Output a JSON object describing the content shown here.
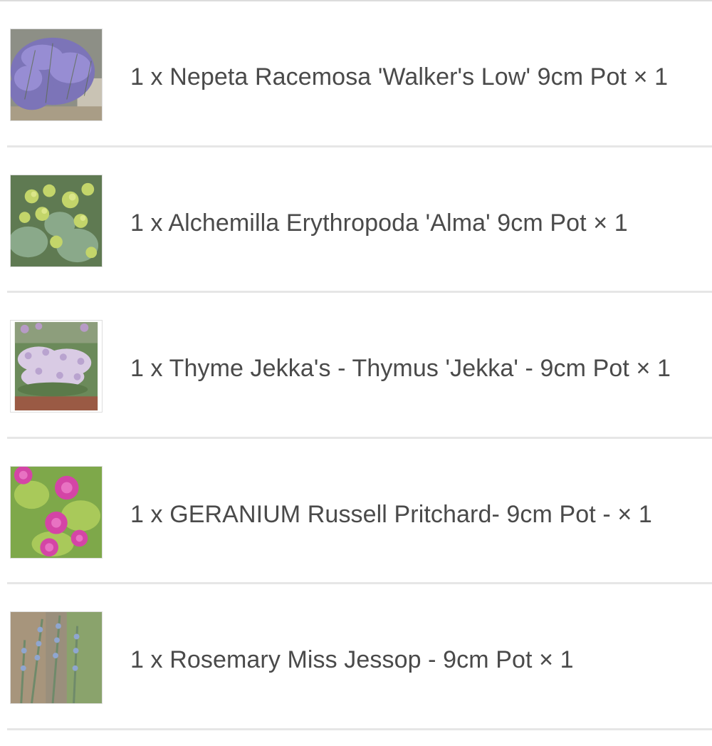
{
  "order_items": [
    {
      "name": "1 x Nepeta Racemosa 'Walker's Low' 9cm Pot",
      "quantity": "× 1",
      "thumbnail": "nepeta-plant-photo"
    },
    {
      "name": "1 x Alchemilla Erythropoda 'Alma' 9cm Pot",
      "quantity": "× 1",
      "thumbnail": "alchemilla-plant-photo"
    },
    {
      "name": "1 x Thyme Jekka's - Thymus 'Jekka' - 9cm Pot",
      "quantity": "× 1",
      "thumbnail": "thyme-plant-photo"
    },
    {
      "name": "1 x GERANIUM Russell Pritchard- 9cm Pot -",
      "quantity": "× 1",
      "thumbnail": "geranium-plant-photo"
    },
    {
      "name": "1 x Rosemary Miss Jessop - 9cm Pot",
      "quantity": "× 1",
      "thumbnail": "rosemary-plant-photo"
    }
  ],
  "colors": {
    "text": "#4a4a4a",
    "divider": "#e6e6e6",
    "background": "#ffffff"
  }
}
